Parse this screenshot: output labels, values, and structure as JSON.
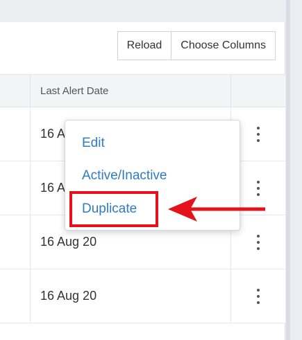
{
  "toolbar": {
    "reload_label": "Reload",
    "choose_columns_label": "Choose Columns"
  },
  "table": {
    "header": {
      "last_alert_date": "Last Alert Date"
    },
    "rows": [
      {
        "last_alert_date": "16 A"
      },
      {
        "last_alert_date": "16 A"
      },
      {
        "last_alert_date": "16 Aug 20"
      },
      {
        "last_alert_date": "16 Aug 20"
      }
    ]
  },
  "context_menu": {
    "items": [
      {
        "label": "Edit"
      },
      {
        "label": "Active/Inactive"
      },
      {
        "label": "Duplicate"
      }
    ]
  },
  "colors": {
    "link": "#2f7bc1",
    "annotation": "#e3121b"
  },
  "icons": {
    "row_menu": "kebab-vertical-icon",
    "pointer": "arrow-left-icon"
  }
}
